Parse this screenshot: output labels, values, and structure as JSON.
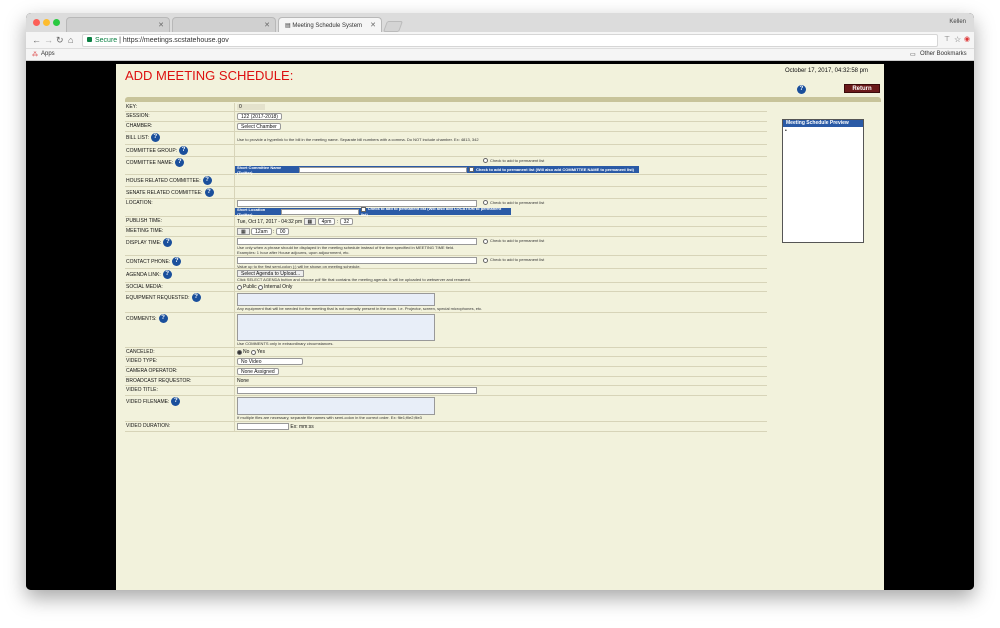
{
  "browser": {
    "tabs": [
      {
        "label": ""
      },
      {
        "label": ""
      },
      {
        "label": "Meeting Schedule System"
      }
    ],
    "user": "Kellen",
    "secure_label": "Secure",
    "url": "https://meetings.scstatehouse.gov",
    "apps_label": "Apps",
    "other_bookmarks": "Other Bookmarks"
  },
  "page": {
    "title": "ADD MEETING SCHEDULE:",
    "datetime": "October 17, 2017, 04:32:58 pm",
    "return_label": "Return",
    "preview_title": "Meeting Schedule Preview"
  },
  "form": {
    "key_label": "KEY:",
    "key_value": "0",
    "session_label": "SESSION:",
    "session_value": "122 (2017-2018)",
    "chamber_label": "CHAMBER:",
    "chamber_value": "Select Chamber",
    "bill_list_label": "BILL LIST:",
    "bill_list_note": "Use to provide a hyperlink to the bill in the meeting name. Separate bill numbers with a comma. Do NOT include chamber. Ex: 4813, 342",
    "committee_group_label": "COMMITTEE GROUP:",
    "committee_name_label": "COMMITTEE NAME:",
    "permanent_list": "Check to add to permanent list",
    "short_committee_name": "Short Committee Name (Twitter)",
    "committee_perm_note": "Check to add to permanent list (Will also add COMMITTEE NAME to permanent list)",
    "house_related_label": "HOUSE RELATED COMMITTEE:",
    "senate_related_label": "SENATE RELATED COMMITTEE:",
    "location_label": "LOCATION:",
    "short_location": "Short Location (Twitter)",
    "location_perm_note": "Check to add to permanent list (Will also add LOCATION to permanent list)",
    "publish_time_label": "PUBLISH TIME:",
    "publish_date": "Tue, Oct 17, 2017 - 04:32 pm",
    "publish_hour": "4pm",
    "publish_min": "32",
    "meeting_time_label": "MEETING TIME:",
    "meeting_hour": "12am",
    "meeting_min": "00",
    "display_time_label": "DISPLAY TIME:",
    "display_time_note1": "Use only when a phrase should be displayed in the meeting schedule instead of the time specified in MEETING TIME field.",
    "display_time_note2": "Examples: 1 hour after House adjourns, upon adjournment, etc.",
    "contact_phone_label": "CONTACT PHONE:",
    "contact_phone_note": "Value up to the first semi-colon (;) will be shown on meeting schedule.",
    "agenda_link_label": "AGENDA LINK:",
    "agenda_button": "Select Agenda to Upload...",
    "agenda_note": "Click SELECT AGENDA button and choose pdf file that contains the meeting agenda. It will be uploaded to webserver and renamed.",
    "social_media_label": "SOCIAL MEDIA:",
    "public_label": "Public",
    "internal_label": "Internal Only",
    "equipment_label": "EQUIPMENT REQUESTED:",
    "equipment_note": "Any equipment that will be needed for the meeting that is not normally present in the room. i.e. Projector, screen, special microphones, etc.",
    "comments_label": "COMMENTS:",
    "comments_note": "Use COMMENTS only in extraordinary circumstances.",
    "canceled_label": "CANCELED:",
    "no_label": "No",
    "yes_label": "Yes",
    "video_type_label": "VIDEO TYPE:",
    "video_type_value": "No Video",
    "camera_operator_label": "CAMERA OPERATOR:",
    "camera_operator_value": "None Assigned",
    "broadcast_requestor_label": "BROADCAST REQUESTOR:",
    "broadcast_requestor_value": "None",
    "video_title_label": "VIDEO TITLE:",
    "video_filename_label": "VIDEO FILENAME:",
    "video_filename_note": "If multiple files are necessary, separate file names with semi-colon in the correct order. Ex: file1;file2;file3",
    "video_duration_label": "VIDEO DURATION:",
    "video_duration_hint": "Ex: mm:ss"
  },
  "icons": {
    "help": "help-icon",
    "reload": "reload-icon",
    "home": "home-icon",
    "star": "star-icon"
  },
  "colors": {
    "title": "#dd1111",
    "page_bg": "#f2f2dc",
    "header_blue": "#2a5aa6",
    "return_bg": "#6b1a1a"
  }
}
